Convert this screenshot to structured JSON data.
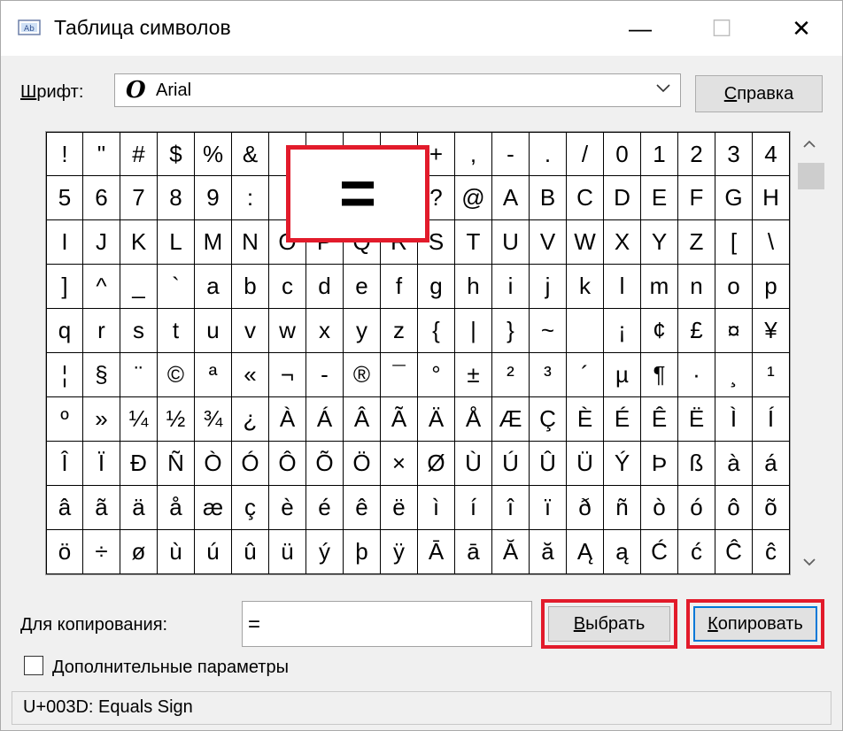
{
  "window": {
    "title": "Таблица символов",
    "minimize_glyph": "—",
    "maximize_glyph": "☐",
    "close_glyph": "✕"
  },
  "font": {
    "label_accel": "Ш",
    "label_rest": "рифт:",
    "selected": "Arial",
    "font_glyph": "O"
  },
  "help_button": {
    "accel": "С",
    "rest": "правка"
  },
  "grid": {
    "columns": 20,
    "cells": [
      "!",
      "\"",
      "#",
      "$",
      "%",
      "&",
      "'",
      "(",
      ")",
      "*",
      "+",
      ",",
      "-",
      ".",
      "/",
      "0",
      "1",
      "2",
      "3",
      "4",
      "5",
      "6",
      "7",
      "8",
      "9",
      ":",
      ";",
      "<",
      "=",
      ">",
      "?",
      "@",
      "A",
      "B",
      "C",
      "D",
      "E",
      "F",
      "G",
      "H",
      "I",
      "J",
      "K",
      "L",
      "M",
      "N",
      "O",
      "P",
      "Q",
      "R",
      "S",
      "T",
      "U",
      "V",
      "W",
      "X",
      "Y",
      "Z",
      "[",
      "\\",
      "]",
      "^",
      "_",
      "`",
      "a",
      "b",
      "c",
      "d",
      "e",
      "f",
      "g",
      "h",
      "i",
      "j",
      "k",
      "l",
      "m",
      "n",
      "o",
      "p",
      "q",
      "r",
      "s",
      "t",
      "u",
      "v",
      "w",
      "x",
      "y",
      "z",
      "{",
      "|",
      "}",
      "~",
      " ",
      "¡",
      "¢",
      "£",
      "¤",
      "¥",
      "¦",
      "§",
      "¨",
      "©",
      "ª",
      "«",
      "¬",
      "-",
      "®",
      "¯",
      "°",
      "±",
      "²",
      "³",
      "´",
      "µ",
      "¶",
      "·",
      "¸",
      "¹",
      "º",
      "»",
      "¼",
      "½",
      "¾",
      "¿",
      "À",
      "Á",
      "Â",
      "Ã",
      "Ä",
      "Å",
      "Æ",
      "Ç",
      "È",
      "É",
      "Ê",
      "Ë",
      "Ì",
      "Í",
      "Î",
      "Ï",
      "Ð",
      "Ñ",
      "Ò",
      "Ó",
      "Ô",
      "Õ",
      "Ö",
      "×",
      "Ø",
      "Ù",
      "Ú",
      "Û",
      "Ü",
      "Ý",
      "Þ",
      "ß",
      "à",
      "á",
      "â",
      "ã",
      "ä",
      "å",
      "æ",
      "ç",
      "è",
      "é",
      "ê",
      "ë",
      "ì",
      "í",
      "î",
      "ï",
      "ð",
      "ñ",
      "ò",
      "ó",
      "ô",
      "õ",
      "ö",
      "÷",
      "ø",
      "ù",
      "ú",
      "û",
      "ü",
      "ý",
      "þ",
      "ÿ",
      "Ā",
      "ā",
      "Ă",
      "ă",
      "Ą",
      "ą",
      "Ć",
      "ć",
      "Ĉ",
      "ĉ"
    ],
    "zoomed_char": "="
  },
  "copy": {
    "label_accel": "Д",
    "label_rest": "ля копирования:",
    "value": "=",
    "select_accel": "В",
    "select_rest": "ыбрать",
    "copy_accel": "К",
    "copy_rest": "опировать"
  },
  "advanced": {
    "label_accel": "Д",
    "label_rest": "ополнительные параметры",
    "checked": false
  },
  "status": {
    "text": "U+003D: Equals Sign"
  },
  "colors": {
    "highlight_red": "#e21b2b",
    "window_bg": "#f0f0f0"
  },
  "icons": {
    "app": "charmap-icon",
    "dropdown": "chevron-down-icon",
    "scroll_up": "chevron-up-icon",
    "scroll_down": "chevron-down-icon"
  }
}
